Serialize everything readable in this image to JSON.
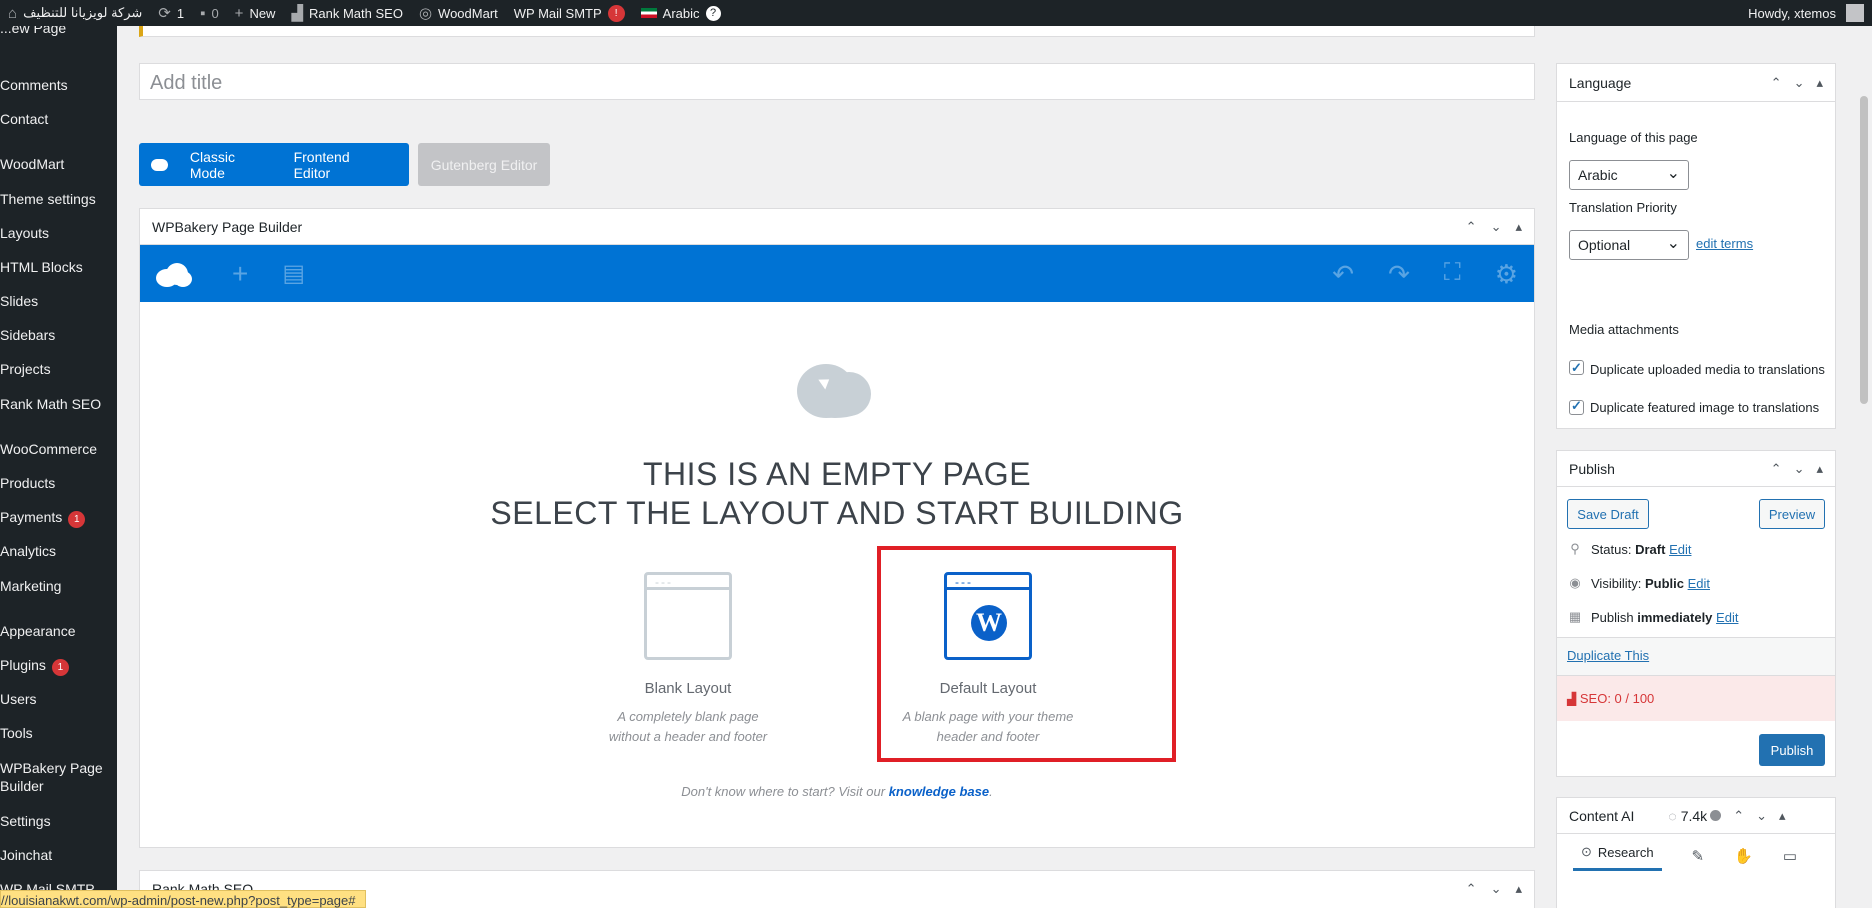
{
  "adminbar": {
    "site_name": "شركة لويزيانا للتنظيف",
    "updates_count": "1",
    "comments_count": "0",
    "new_label": "New",
    "rankmath_label": "Rank Math SEO",
    "woodmart_label": "WoodMart",
    "smtp_label": "WP Mail SMTP",
    "smtp_badge": "!",
    "language_label": "Arabic",
    "howdy": "Howdy, xtemos"
  },
  "sidebar": {
    "items": [
      {
        "label": "...ew Page"
      },
      {
        "label": "Comments"
      },
      {
        "label": "Contact"
      },
      {
        "label": "WoodMart"
      },
      {
        "label": "Theme settings"
      },
      {
        "label": "Layouts"
      },
      {
        "label": "HTML Blocks"
      },
      {
        "label": "Slides"
      },
      {
        "label": "Sidebars"
      },
      {
        "label": "Projects"
      },
      {
        "label": "Rank Math SEO"
      },
      {
        "label": "WooCommerce"
      },
      {
        "label": "Products"
      },
      {
        "label": "Payments",
        "badge": "1"
      },
      {
        "label": "Analytics"
      },
      {
        "label": "Marketing"
      },
      {
        "label": "Appearance"
      },
      {
        "label": "Plugins",
        "badge": "1"
      },
      {
        "label": "Users"
      },
      {
        "label": "Tools"
      },
      {
        "label": "WPBakery Page Builder"
      },
      {
        "label": "Settings"
      },
      {
        "label": "Joinchat"
      },
      {
        "label": "WP Mail SMTP"
      }
    ]
  },
  "editor": {
    "title_placeholder": "Add title",
    "classic_mode": "Classic Mode",
    "frontend_editor": "Frontend Editor",
    "gutenberg_editor": "Gutenberg Editor"
  },
  "wpbakery": {
    "box_title": "WPBakery Page Builder",
    "empty_line1": "THIS IS AN EMPTY PAGE",
    "empty_line2": "SELECT THE LAYOUT AND START BUILDING",
    "blank_layout": {
      "name": "Blank Layout",
      "desc1": "A completely blank page",
      "desc2": "without a header and footer"
    },
    "default_layout": {
      "name": "Default Layout",
      "desc1": "A blank page with your theme",
      "desc2": "header and footer"
    },
    "kb_prefix": "Don't know where to start? Visit our",
    "kb_link": "knowledge base",
    "kb_suffix": "."
  },
  "rankmath_box": {
    "title": "Rank Math SEO"
  },
  "status_url": "//louisianakwt.com/wp-admin/post-new.php?post_type=page#",
  "language_box": {
    "title": "Language",
    "page_lang_label": "Language of this page",
    "page_lang_value": "Arabic",
    "priority_label": "Translation Priority",
    "priority_value": "Optional",
    "edit_terms": "edit terms",
    "media_label": "Media attachments",
    "dup_media": "Duplicate uploaded media to translations",
    "dup_featured": "Duplicate featured image to translations"
  },
  "publish_box": {
    "title": "Publish",
    "save_draft": "Save Draft",
    "preview": "Preview",
    "status_label": "Status:",
    "status_value": "Draft",
    "visibility_label": "Visibility:",
    "visibility_value": "Public",
    "publish_label": "Publish",
    "publish_value": "immediately",
    "edit": "Edit",
    "duplicate": "Duplicate This",
    "seo_score": "SEO: 0 / 100",
    "publish_btn": "Publish"
  },
  "content_ai": {
    "title": "Content AI",
    "credits": "7.4k",
    "research_tab": "Research"
  },
  "colors": {
    "wp_blue": "#0073d4",
    "highlight_red": "#e01f26",
    "admin_dark": "#1d2327"
  }
}
